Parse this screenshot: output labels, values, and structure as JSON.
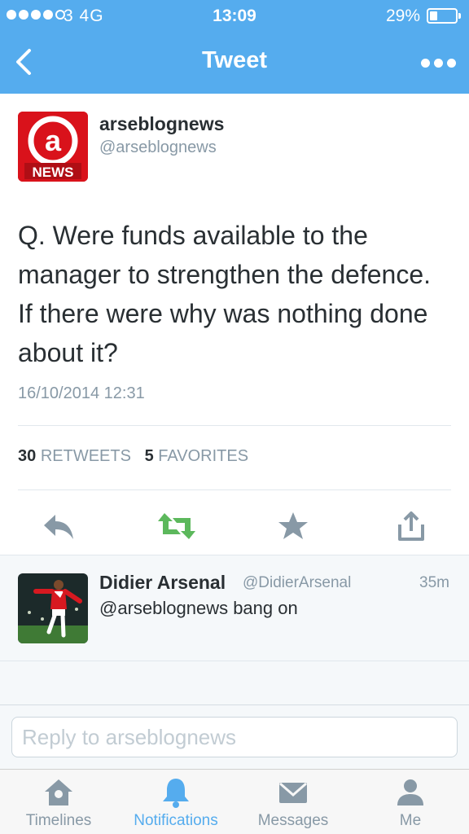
{
  "status_bar": {
    "carrier": "3  4G",
    "time": "13:09",
    "battery_pct": "29%",
    "battery_level": 0.29,
    "signal_filled": 4,
    "signal_total": 5
  },
  "nav": {
    "title": "Tweet",
    "back_icon": "chevron-left-icon",
    "more_icon": "more-dots-icon"
  },
  "tweet": {
    "author_name": "arseblognews",
    "author_handle": "@arseblognews",
    "avatar_text": "NEWS",
    "text": "Q. Were funds available to the manager to strengthen the defence. If there were why was nothing done about it?",
    "timestamp": "16/10/2014 12:31",
    "retweets_count": "30",
    "retweets_label": "RETWEETS",
    "favorites_count": "5",
    "favorites_label": "FAVORITES"
  },
  "actions": [
    "reply-icon",
    "retweet-icon",
    "favorite-icon",
    "share-icon"
  ],
  "reply": {
    "name": "Didier Arsenal",
    "handle": "@DidierArsenal",
    "age": "35m",
    "text": "@arseblognews bang on"
  },
  "compose": {
    "placeholder": "Reply to arseblognews"
  },
  "tabs": [
    {
      "label": "Timelines",
      "icon": "home-icon",
      "active": false
    },
    {
      "label": "Notifications",
      "icon": "bell-icon",
      "active": true
    },
    {
      "label": "Messages",
      "icon": "envelope-icon",
      "active": false
    },
    {
      "label": "Me",
      "icon": "person-icon",
      "active": false
    }
  ],
  "colors": {
    "brand": "#55acee",
    "retweet_green": "#5cb85c",
    "muted": "#8899a6",
    "news_red": "#d9121b"
  }
}
